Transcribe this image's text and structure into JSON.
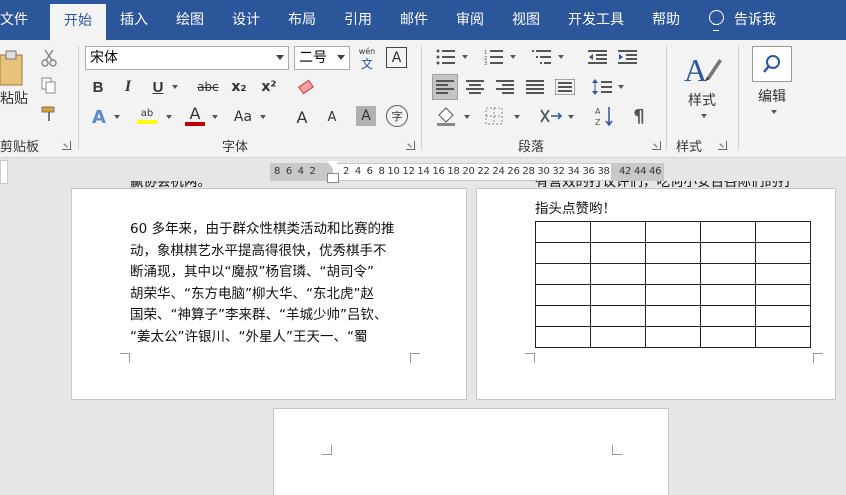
{
  "menu": {
    "items": [
      "文件",
      "开始",
      "插入",
      "绘图",
      "设计",
      "布局",
      "引用",
      "邮件",
      "审阅",
      "视图",
      "开发工具",
      "帮助"
    ],
    "active_index": 1,
    "tell_me": "告诉我"
  },
  "ribbon": {
    "clipboard": {
      "paste_label": "粘贴",
      "group_label": "剪贴板"
    },
    "font": {
      "name": "宋体",
      "size": "二号",
      "group_label": "字体",
      "bold": "B",
      "italic": "I",
      "underline": "U",
      "strike": "abc",
      "subscript": "x₂",
      "superscript": "x²",
      "font_color": "A",
      "change_case": "Aa",
      "grow": "A",
      "shrink": "A",
      "char_shade": "A",
      "enclose": "字",
      "phonetic_top": "wén",
      "phonetic_bottom": "文",
      "char_border": "A"
    },
    "paragraph": {
      "group_label": "段落"
    },
    "styles": {
      "label": "样式",
      "group_label": "样式"
    },
    "editing": {
      "label": "编辑"
    }
  },
  "ruler": {
    "left_numbers": "8  6  4  2",
    "numbers": "2  4  6  8 10 12 14 16 18 20 22 24 26 28 30 32 34 36 38",
    "right_numbers": "42 44 46"
  },
  "page1": {
    "top_partial": "赢协会杭两。",
    "lines": [
      "60 多年来，由于群众性棋类活动和比赛的推",
      "动，象棋棋艺水平提高得很快，优秀棋手不",
      "断涌现，其中以“魔叔”杨官璘、“胡司令”",
      "胡荣华、“东方电脑”柳大华、“东北虎”赵",
      "国荣、“神算子”李来群、“羊城少帅”吕钦、",
      "“姜太公”许银川、“外星人”王天一、“蜀"
    ]
  },
  "page2": {
    "top_partial": "有营效的打议评们，吃何小安百吝际们的打",
    "line": "指头点赞哟！",
    "table_rows": 6,
    "table_cols": 5
  },
  "colors": {
    "title_bar": "#2b579a",
    "ribbon_bg": "#f3f3f3",
    "highlight": "#ffff00",
    "font_color": "#c00000"
  }
}
